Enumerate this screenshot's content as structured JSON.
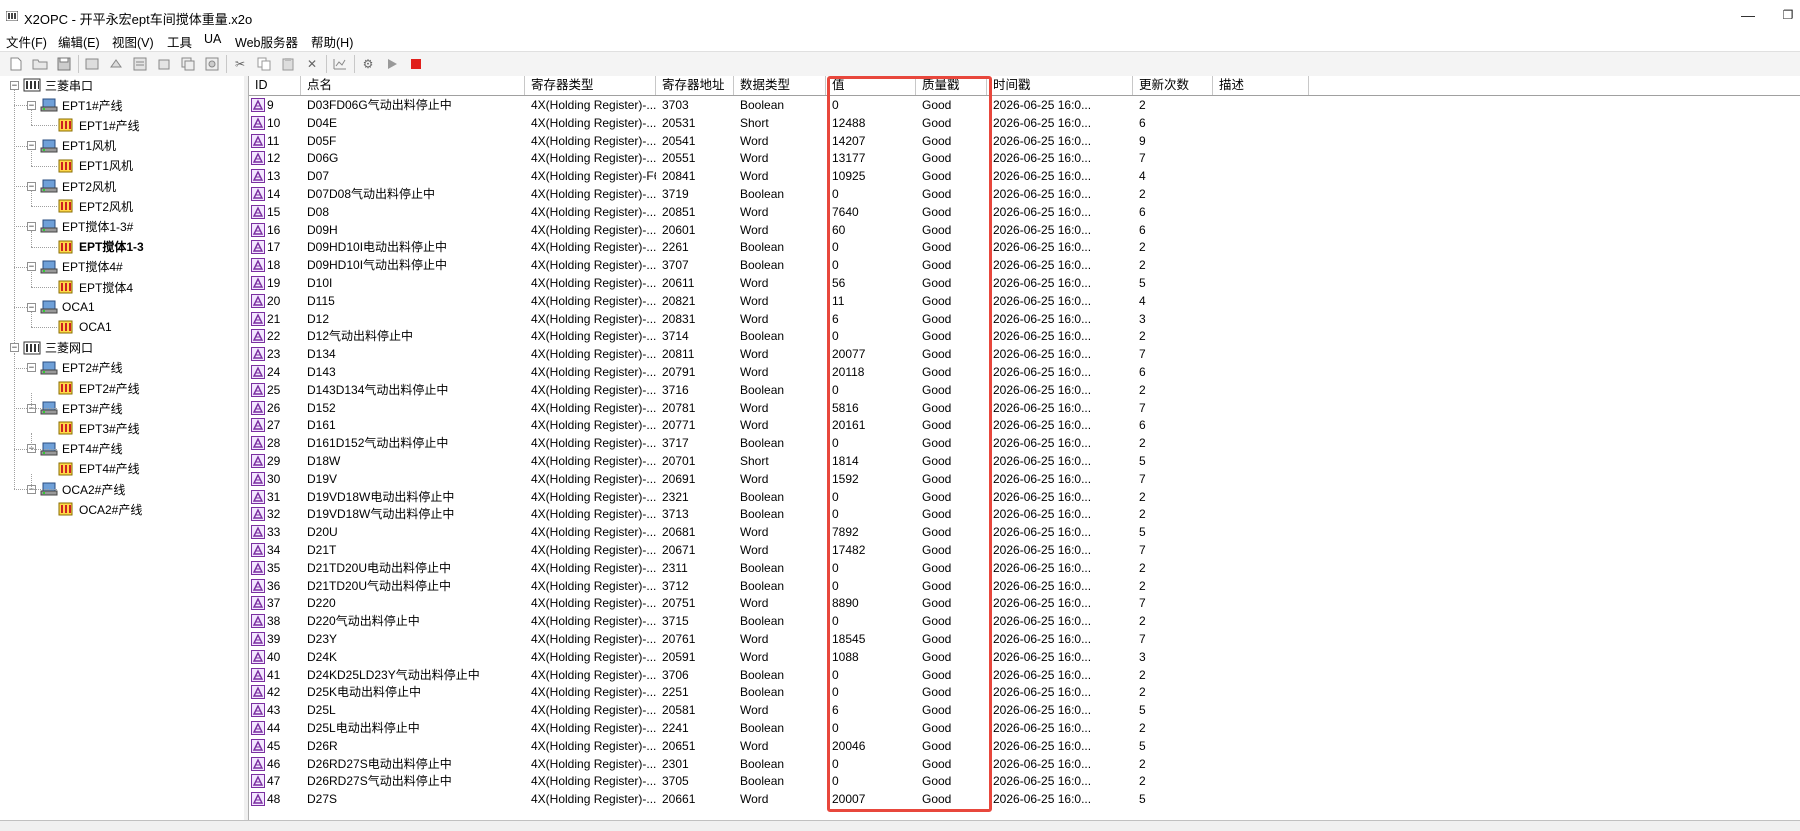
{
  "window": {
    "title": "X2OPC - 开平永宏ept车间搅体重量.x2o",
    "minimize": "—",
    "restore": "❐"
  },
  "menu": [
    "文件(F)",
    "编辑(E)",
    "视图(V)",
    "工具",
    "UA",
    "Web服务器",
    "帮助(H)"
  ],
  "tree": [
    {
      "label": "三菱串口",
      "level": 0,
      "type": "channel",
      "expander": "−"
    },
    {
      "label": "EPT1#产线",
      "level": 1,
      "type": "device",
      "expander": "−"
    },
    {
      "label": "EPT1#产线",
      "level": 2,
      "type": "group"
    },
    {
      "label": "EPT1风机",
      "level": 1,
      "type": "device",
      "expander": "−"
    },
    {
      "label": "EPT1风机",
      "level": 2,
      "type": "group"
    },
    {
      "label": "EPT2风机",
      "level": 1,
      "type": "device",
      "expander": "−"
    },
    {
      "label": "EPT2风机",
      "level": 2,
      "type": "group"
    },
    {
      "label": "EPT搅体1-3#",
      "level": 1,
      "type": "device",
      "expander": "−"
    },
    {
      "label": "EPT搅体1-3",
      "level": 2,
      "type": "group",
      "selected": true
    },
    {
      "label": "EPT搅体4#",
      "level": 1,
      "type": "device",
      "expander": "−"
    },
    {
      "label": "EPT搅体4",
      "level": 2,
      "type": "group"
    },
    {
      "label": "OCA1",
      "level": 1,
      "type": "device",
      "expander": "−"
    },
    {
      "label": "OCA1",
      "level": 2,
      "type": "group"
    },
    {
      "label": "三菱网口",
      "level": 0,
      "type": "channel",
      "expander": "−"
    },
    {
      "label": "EPT2#产线",
      "level": 1,
      "type": "device",
      "expander": "−"
    },
    {
      "label": "EPT2#产线",
      "level": 2,
      "type": "group"
    },
    {
      "label": "EPT3#产线",
      "level": 1,
      "type": "device",
      "expander": "−"
    },
    {
      "label": "EPT3#产线",
      "level": 2,
      "type": "group"
    },
    {
      "label": "EPT4#产线",
      "level": 1,
      "type": "device",
      "expander": "−"
    },
    {
      "label": "EPT4#产线",
      "level": 2,
      "type": "group"
    },
    {
      "label": "OCA2#产线",
      "level": 1,
      "type": "device",
      "expander": "−"
    },
    {
      "label": "OCA2#产线",
      "level": 2,
      "type": "group"
    }
  ],
  "columns": [
    "ID",
    "点名",
    "寄存器类型",
    "寄存器地址",
    "数据类型",
    "值",
    "质量戳",
    "时间戳",
    "更新次数",
    "描述"
  ],
  "rows": [
    [
      "9",
      "D03FD06G气动出料停止中",
      "4X(Holding Register)-...",
      "3703",
      "Boolean",
      "0",
      "Good",
      "2026-06-25 16:0...",
      "2"
    ],
    [
      "10",
      "D04E",
      "4X(Holding Register)-...",
      "20531",
      "Short",
      "12488",
      "Good",
      "2026-06-25 16:0...",
      "6"
    ],
    [
      "11",
      "D05F",
      "4X(Holding Register)-...",
      "20541",
      "Word",
      "14207",
      "Good",
      "2026-06-25 16:0...",
      "9"
    ],
    [
      "12",
      "D06G",
      "4X(Holding Register)-...",
      "20551",
      "Word",
      "13177",
      "Good",
      "2026-06-25 16:0...",
      "7"
    ],
    [
      "13",
      "D07",
      "4X(Holding Register)-F6",
      "20841",
      "Word",
      "10925",
      "Good",
      "2026-06-25 16:0...",
      "4"
    ],
    [
      "14",
      "D07D08气动出料停止中",
      "4X(Holding Register)-...",
      "3719",
      "Boolean",
      "0",
      "Good",
      "2026-06-25 16:0...",
      "2"
    ],
    [
      "15",
      "D08",
      "4X(Holding Register)-...",
      "20851",
      "Word",
      "7640",
      "Good",
      "2026-06-25 16:0...",
      "6"
    ],
    [
      "16",
      "D09H",
      "4X(Holding Register)-...",
      "20601",
      "Word",
      "60",
      "Good",
      "2026-06-25 16:0...",
      "6"
    ],
    [
      "17",
      "D09HD10I电动出料停止中",
      "4X(Holding Register)-...",
      "2261",
      "Boolean",
      "0",
      "Good",
      "2026-06-25 16:0...",
      "2"
    ],
    [
      "18",
      "D09HD10I气动出料停止中",
      "4X(Holding Register)-...",
      "3707",
      "Boolean",
      "0",
      "Good",
      "2026-06-25 16:0...",
      "2"
    ],
    [
      "19",
      "D10I",
      "4X(Holding Register)-...",
      "20611",
      "Word",
      "56",
      "Good",
      "2026-06-25 16:0...",
      "5"
    ],
    [
      "20",
      "D115",
      "4X(Holding Register)-...",
      "20821",
      "Word",
      "11",
      "Good",
      "2026-06-25 16:0...",
      "4"
    ],
    [
      "21",
      "D12",
      "4X(Holding Register)-...",
      "20831",
      "Word",
      "6",
      "Good",
      "2026-06-25 16:0...",
      "3"
    ],
    [
      "22",
      "D12气动出料停止中",
      "4X(Holding Register)-...",
      "3714",
      "Boolean",
      "0",
      "Good",
      "2026-06-25 16:0...",
      "2"
    ],
    [
      "23",
      "D134",
      "4X(Holding Register)-...",
      "20811",
      "Word",
      "20077",
      "Good",
      "2026-06-25 16:0...",
      "7"
    ],
    [
      "24",
      "D143",
      "4X(Holding Register)-...",
      "20791",
      "Word",
      "20118",
      "Good",
      "2026-06-25 16:0...",
      "6"
    ],
    [
      "25",
      "D143D134气动出料停止中",
      "4X(Holding Register)-...",
      "3716",
      "Boolean",
      "0",
      "Good",
      "2026-06-25 16:0...",
      "2"
    ],
    [
      "26",
      "D152",
      "4X(Holding Register)-...",
      "20781",
      "Word",
      "5816",
      "Good",
      "2026-06-25 16:0...",
      "7"
    ],
    [
      "27",
      "D161",
      "4X(Holding Register)-...",
      "20771",
      "Word",
      "20161",
      "Good",
      "2026-06-25 16:0...",
      "6"
    ],
    [
      "28",
      "D161D152气动出料停止中",
      "4X(Holding Register)-...",
      "3717",
      "Boolean",
      "0",
      "Good",
      "2026-06-25 16:0...",
      "2"
    ],
    [
      "29",
      "D18W",
      "4X(Holding Register)-...",
      "20701",
      "Short",
      "1814",
      "Good",
      "2026-06-25 16:0...",
      "5"
    ],
    [
      "30",
      "D19V",
      "4X(Holding Register)-...",
      "20691",
      "Word",
      "1592",
      "Good",
      "2026-06-25 16:0...",
      "7"
    ],
    [
      "31",
      "D19VD18W电动出料停止中",
      "4X(Holding Register)-...",
      "2321",
      "Boolean",
      "0",
      "Good",
      "2026-06-25 16:0...",
      "2"
    ],
    [
      "32",
      "D19VD18W气动出料停止中",
      "4X(Holding Register)-...",
      "3713",
      "Boolean",
      "0",
      "Good",
      "2026-06-25 16:0...",
      "2"
    ],
    [
      "33",
      "D20U",
      "4X(Holding Register)-...",
      "20681",
      "Word",
      "7892",
      "Good",
      "2026-06-25 16:0...",
      "5"
    ],
    [
      "34",
      "D21T",
      "4X(Holding Register)-...",
      "20671",
      "Word",
      "17482",
      "Good",
      "2026-06-25 16:0...",
      "7"
    ],
    [
      "35",
      "D21TD20U电动出料停止中",
      "4X(Holding Register)-...",
      "2311",
      "Boolean",
      "0",
      "Good",
      "2026-06-25 16:0...",
      "2"
    ],
    [
      "36",
      "D21TD20U气动出料停止中",
      "4X(Holding Register)-...",
      "3712",
      "Boolean",
      "0",
      "Good",
      "2026-06-25 16:0...",
      "2"
    ],
    [
      "37",
      "D220",
      "4X(Holding Register)-...",
      "20751",
      "Word",
      "8890",
      "Good",
      "2026-06-25 16:0...",
      "7"
    ],
    [
      "38",
      "D220气动出料停止中",
      "4X(Holding Register)-...",
      "3715",
      "Boolean",
      "0",
      "Good",
      "2026-06-25 16:0...",
      "2"
    ],
    [
      "39",
      "D23Y",
      "4X(Holding Register)-...",
      "20761",
      "Word",
      "18545",
      "Good",
      "2026-06-25 16:0...",
      "7"
    ],
    [
      "40",
      "D24K",
      "4X(Holding Register)-...",
      "20591",
      "Word",
      "1088",
      "Good",
      "2026-06-25 16:0...",
      "3"
    ],
    [
      "41",
      "D24KD25LD23Y气动出料停止中",
      "4X(Holding Register)-...",
      "3706",
      "Boolean",
      "0",
      "Good",
      "2026-06-25 16:0...",
      "2"
    ],
    [
      "42",
      "D25K电动出料停止中",
      "4X(Holding Register)-...",
      "2251",
      "Boolean",
      "0",
      "Good",
      "2026-06-25 16:0...",
      "2"
    ],
    [
      "43",
      "D25L",
      "4X(Holding Register)-...",
      "20581",
      "Word",
      "6",
      "Good",
      "2026-06-25 16:0...",
      "5"
    ],
    [
      "44",
      "D25L电动出料停止中",
      "4X(Holding Register)-...",
      "2241",
      "Boolean",
      "0",
      "Good",
      "2026-06-25 16:0...",
      "2"
    ],
    [
      "45",
      "D26R",
      "4X(Holding Register)-...",
      "20651",
      "Word",
      "20046",
      "Good",
      "2026-06-25 16:0...",
      "5"
    ],
    [
      "46",
      "D26RD27S电动出料停止中",
      "4X(Holding Register)-...",
      "2301",
      "Boolean",
      "0",
      "Good",
      "2026-06-25 16:0...",
      "2"
    ],
    [
      "47",
      "D26RD27S气动出料停止中",
      "4X(Holding Register)-...",
      "3705",
      "Boolean",
      "0",
      "Good",
      "2026-06-25 16:0...",
      "2"
    ],
    [
      "48",
      "D27S",
      "4X(Holding Register)-...",
      "20661",
      "Word",
      "20007",
      "Good",
      "2026-06-25 16:0...",
      "5"
    ]
  ],
  "colors": {
    "highlight": "#e8473c",
    "tag_icon": "#7a2fa0",
    "stop_button": "#e0201c"
  }
}
